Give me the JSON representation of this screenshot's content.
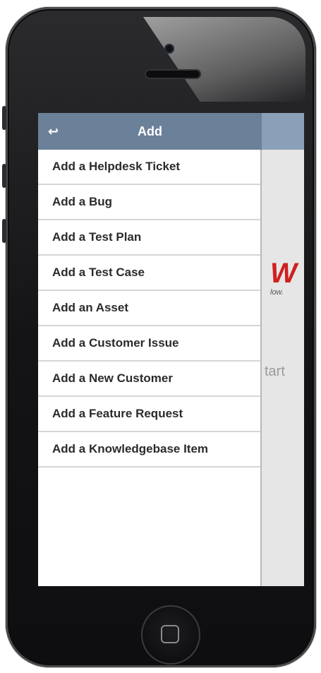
{
  "header": {
    "title": "Add",
    "back_icon": "back-arrow-icon"
  },
  "menu": {
    "items": [
      {
        "label": "Add a Helpdesk Ticket"
      },
      {
        "label": "Add a Bug"
      },
      {
        "label": "Add a Test Plan"
      },
      {
        "label": "Add a Test Case"
      },
      {
        "label": "Add an Asset"
      },
      {
        "label": "Add a Customer Issue"
      },
      {
        "label": "Add a New Customer"
      },
      {
        "label": "Add a Feature Request"
      },
      {
        "label": "Add a Knowledgebase Item"
      }
    ]
  },
  "background": {
    "logo_fragment": "W",
    "tagline_fragment": "low.",
    "button_fragment": "tart"
  },
  "colors": {
    "header_bg": "#6b8099",
    "accent_red": "#d01f1f"
  }
}
